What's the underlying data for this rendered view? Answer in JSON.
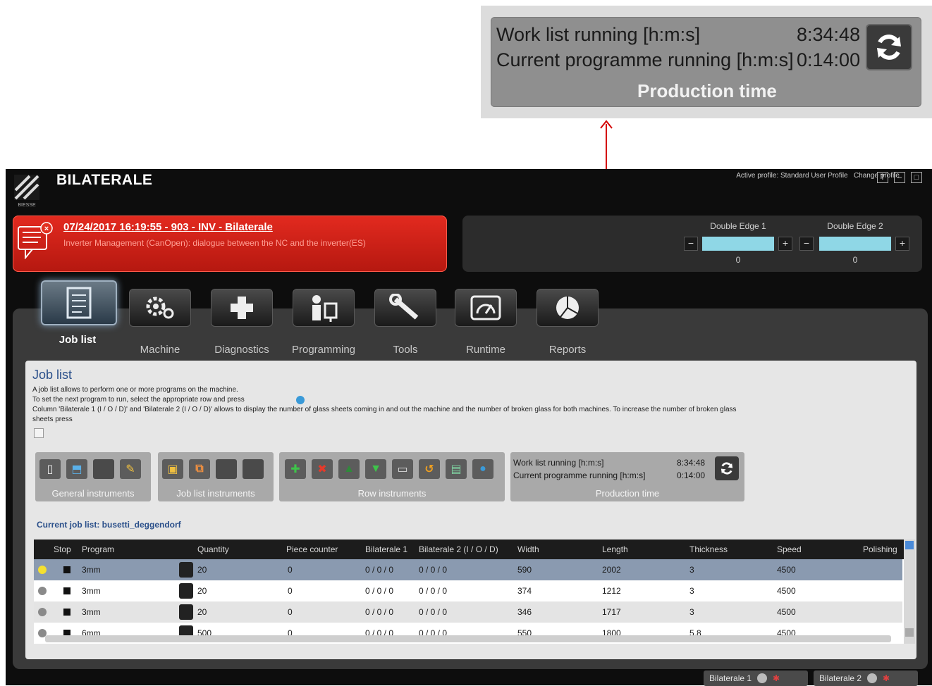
{
  "callout": {
    "work_list_label": "Work list running [h:m:s]",
    "work_list_value": "8:34:48",
    "current_programme_label": "Current programme running [h:m:s]",
    "current_programme_value": "0:14:00",
    "title": "Production time",
    "refresh_icon": "refresh-icon"
  },
  "header": {
    "app_title": "BILATERALE",
    "logo_caption": "BIESSE",
    "profile_text": "Active profile: Standard User Profile",
    "change_profile": "Change profile"
  },
  "alarm": {
    "title": "07/24/2017 16:19:55 - 903 - INV - Bilaterale",
    "description": "Inverter Management (CanOpen): dialogue between the NC and the inverter(ES)",
    "color": "#d8281e"
  },
  "edges": [
    {
      "label": "Double Edge 1",
      "value": "0"
    },
    {
      "label": "Double Edge 2",
      "value": "0"
    }
  ],
  "tabs": [
    {
      "label": "Job list",
      "icon": "document-icon",
      "active": true
    },
    {
      "label": "Machine",
      "icon": "gears-icon",
      "active": false
    },
    {
      "label": "Diagnostics",
      "icon": "cross-icon",
      "active": false
    },
    {
      "label": "Programming",
      "icon": "operator-icon",
      "active": false
    },
    {
      "label": "Tools",
      "icon": "wrench-icon",
      "active": false
    },
    {
      "label": "Runtime",
      "icon": "gauge-icon",
      "active": false
    },
    {
      "label": "Reports",
      "icon": "pie-chart-icon",
      "active": false
    }
  ],
  "content": {
    "title": "Job list",
    "desc1": "A job list allows to perform one or more programs on the machine.",
    "desc2": "To set the next program to run, select the appropriate row and press",
    "desc3": "Column 'Bilaterale 1 (I / O / D)' and 'Bilaterale 2 (I / O / D)' allows to display the number of glass sheets coming in and out the machine and the number of broken glass for both machines. To increase the number of broken glass",
    "desc4": "sheets press",
    "groups": {
      "general": "General instruments",
      "job_list": "Job list instruments",
      "row": "Row instruments"
    },
    "production": {
      "work_list_label": "Work list running [h:m:s]",
      "work_list_value": "8:34:48",
      "current_programme_label": "Current programme running [h:m:s]",
      "current_programme_value": "0:14:00",
      "title": "Production time"
    },
    "current_job_list": "Current job list: busetti_deggendorf"
  },
  "table": {
    "columns": [
      "Stop",
      "Program",
      "Quantity",
      "Piece counter",
      "Bilaterale 1",
      "Bilaterale 2 (I / O / D)",
      "Width",
      "Length",
      "Thickness",
      "Speed",
      "Polishing"
    ],
    "rows": [
      {
        "status": "yellow",
        "program": "3mm",
        "quantity": "20",
        "piece_counter": "0",
        "bil1": "0 / 0 / 0",
        "bil2": "0 / 0 / 0",
        "width": "590",
        "length": "2002",
        "thickness": "3",
        "speed": "4500"
      },
      {
        "status": "grey",
        "program": "3mm",
        "quantity": "20",
        "piece_counter": "0",
        "bil1": "0 / 0 / 0",
        "bil2": "0 / 0 / 0",
        "width": "374",
        "length": "1212",
        "thickness": "3",
        "speed": "4500"
      },
      {
        "status": "grey",
        "program": "3mm",
        "quantity": "20",
        "piece_counter": "0",
        "bil1": "0 / 0 / 0",
        "bil2": "0 / 0 / 0",
        "width": "346",
        "length": "1717",
        "thickness": "3",
        "speed": "4500"
      },
      {
        "status": "grey",
        "program": "6mm",
        "quantity": "500",
        "piece_counter": "0",
        "bil1": "0 / 0 / 0",
        "bil2": "0 / 0 / 0",
        "width": "550",
        "length": "1800",
        "thickness": "5.8",
        "speed": "4500"
      }
    ]
  },
  "status_bar": [
    {
      "label": "Bilaterale 1"
    },
    {
      "label": "Bilaterale 2"
    }
  ]
}
